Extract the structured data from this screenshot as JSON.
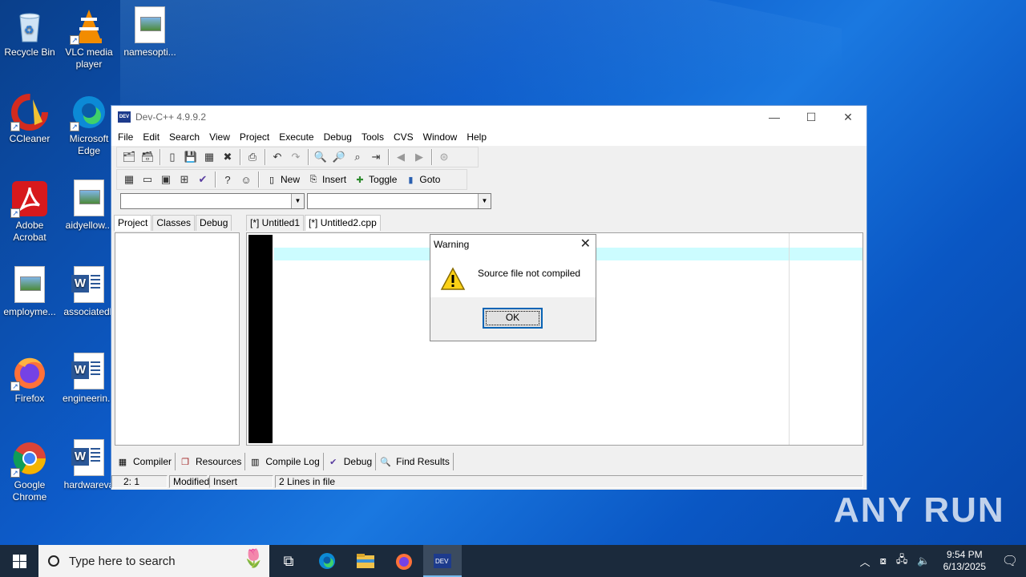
{
  "desktop": {
    "icons": [
      {
        "label": "Recycle Bin",
        "icon": "recycle-bin-icon"
      },
      {
        "label": "VLC media player",
        "icon": "vlc-icon"
      },
      {
        "label": "namesopti...",
        "icon": "image-file-icon"
      },
      {
        "label": "CCleaner",
        "icon": "ccleaner-icon"
      },
      {
        "label": "Microsoft Edge",
        "icon": "edge-icon"
      },
      {
        "label": "Adobe Acrobat",
        "icon": "acrobat-icon"
      },
      {
        "label": "aidyellow...",
        "icon": "image-file-icon"
      },
      {
        "label": "employme...",
        "icon": "image-file-icon"
      },
      {
        "label": "associatedk",
        "icon": "word-doc-icon"
      },
      {
        "label": "Firefox",
        "icon": "firefox-icon"
      },
      {
        "label": "engineerin...",
        "icon": "word-doc-icon"
      },
      {
        "label": "Google Chrome",
        "icon": "chrome-icon"
      },
      {
        "label": "hardwareva",
        "icon": "word-doc-icon"
      }
    ]
  },
  "window": {
    "title": "Dev-C++ 4.9.9.2",
    "menu": [
      "File",
      "Edit",
      "Search",
      "View",
      "Project",
      "Execute",
      "Debug",
      "Tools",
      "CVS",
      "Window",
      "Help"
    ],
    "toolbar2": {
      "new": "New",
      "insert": "Insert",
      "toggle": "Toggle",
      "goto": "Goto"
    },
    "left_tabs": [
      "Project",
      "Classes",
      "Debug"
    ],
    "editor_tabs": [
      "[*] Untitled1",
      "[*] Untitled2.cpp"
    ],
    "bottom_tabs": [
      "Compiler",
      "Resources",
      "Compile Log",
      "Debug",
      "Find Results"
    ],
    "status": {
      "position": "2: 1",
      "modified": "Modified",
      "mode": "Insert",
      "lines": "2 Lines in file"
    },
    "colors": {
      "current_line": "#ccfcff",
      "gutter": "#000000"
    }
  },
  "dialog": {
    "title": "Warning",
    "message": "Source file not compiled",
    "ok_label": "OK",
    "icon": "warning-icon"
  },
  "taskbar": {
    "search_placeholder": "Type here to search",
    "time": "9:54 PM",
    "date": "6/13/2025",
    "apps": [
      "task-view-icon",
      "edge-icon",
      "file-explorer-icon",
      "firefox-icon",
      "devcpp-icon"
    ]
  },
  "watermark": "ANY RUN"
}
